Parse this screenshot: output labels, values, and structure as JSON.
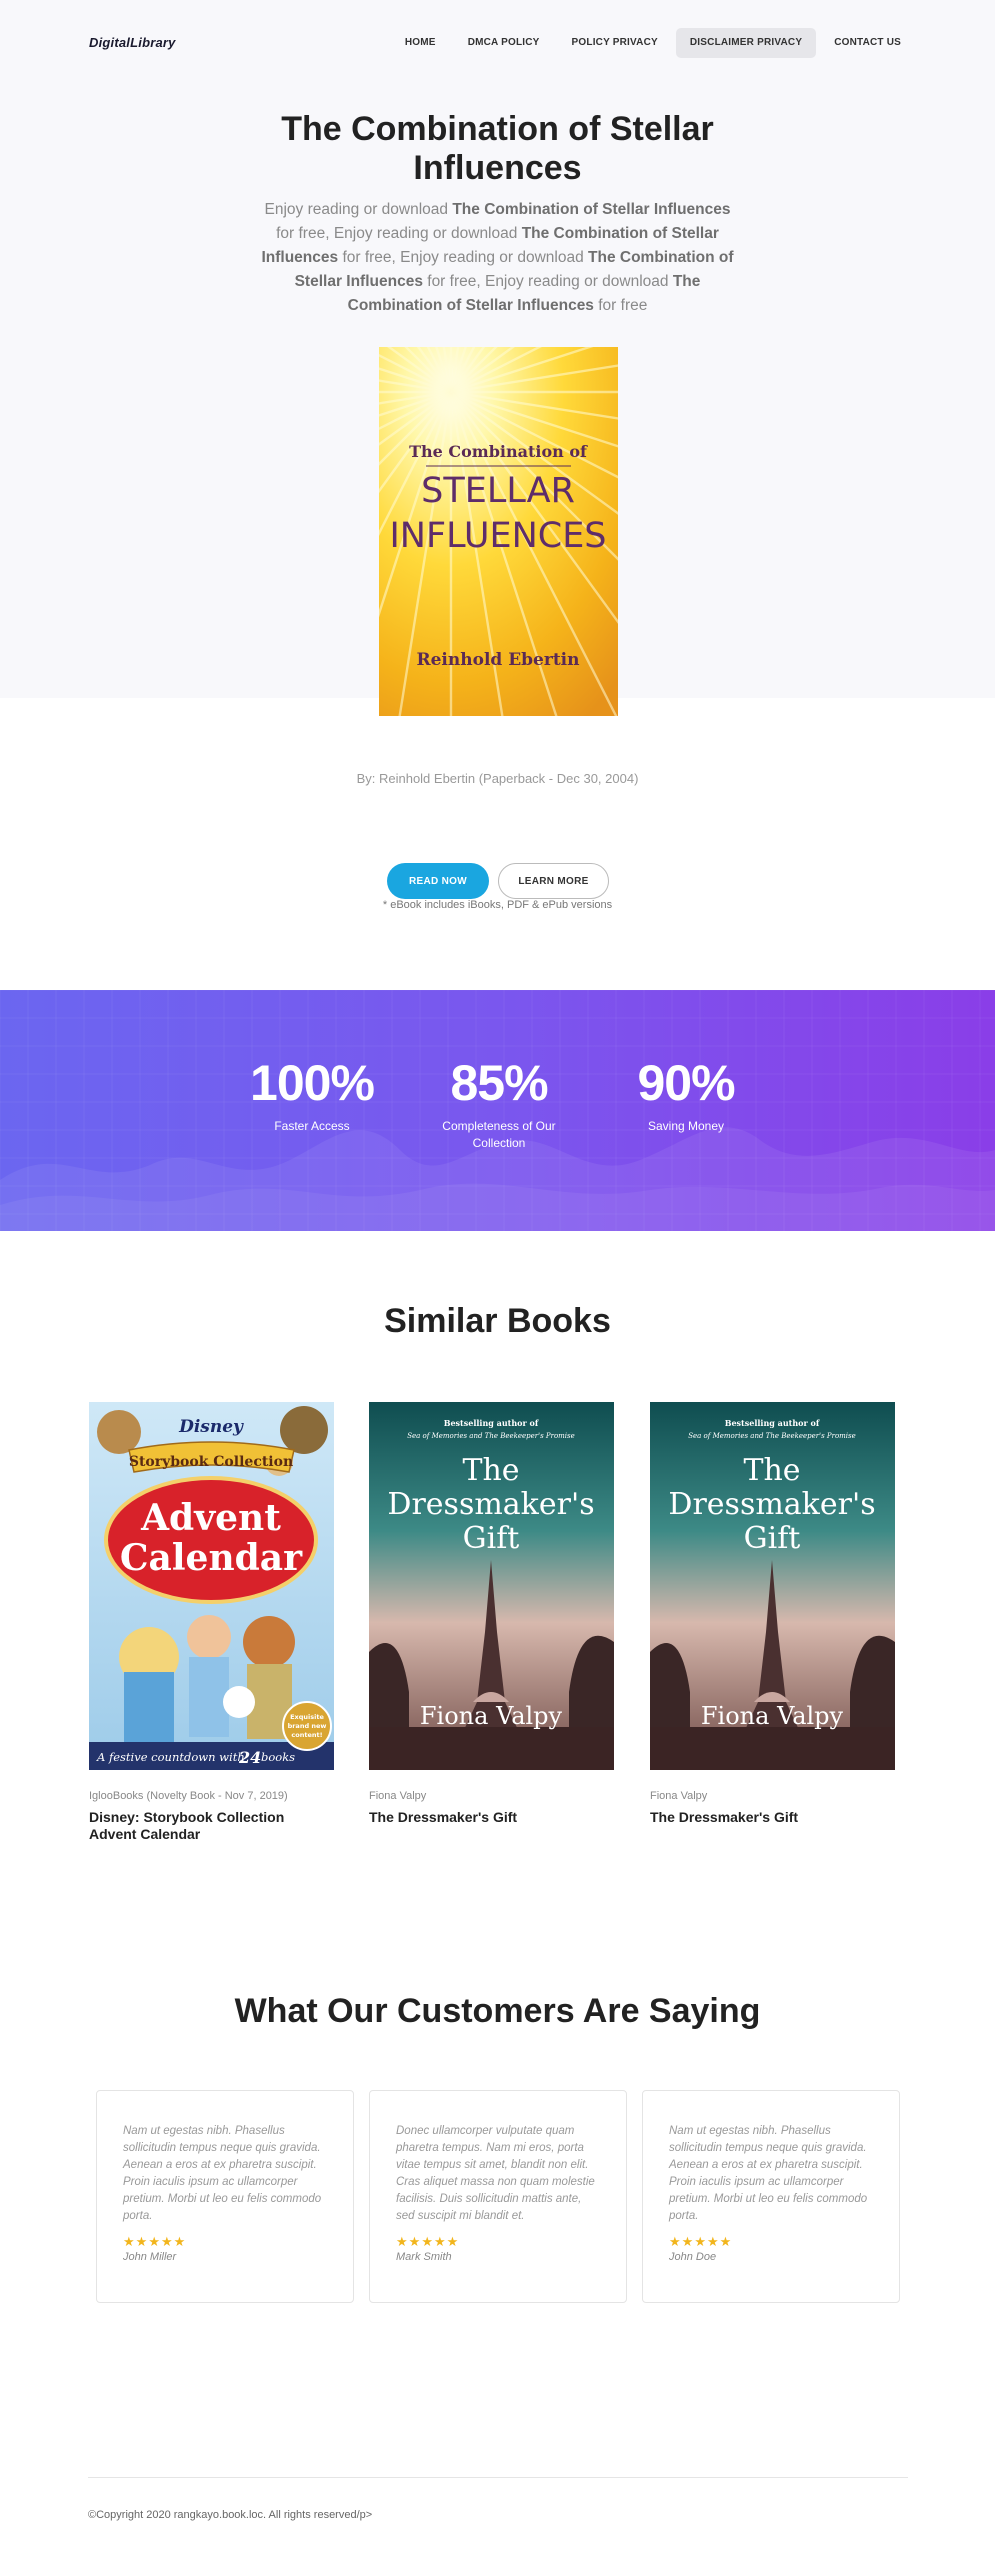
{
  "brand": {
    "logo": "DigitalLibrary"
  },
  "nav": {
    "items": [
      {
        "label": "HOME",
        "active": false
      },
      {
        "label": "DMCA POLICY",
        "active": false
      },
      {
        "label": "POLICY PRIVACY",
        "active": false
      },
      {
        "label": "DISCLAIMER PRIVACY",
        "active": true
      },
      {
        "label": "CONTACT US",
        "active": false
      }
    ]
  },
  "hero": {
    "title": "The Combination of Stellar Influences",
    "description_segments": [
      {
        "text": "Enjoy reading or download ",
        "bold": false
      },
      {
        "text": "The Combination of Stellar Influences",
        "bold": true
      },
      {
        "text": " for free, Enjoy reading or download ",
        "bold": false
      },
      {
        "text": "The Combination of Stellar Influences",
        "bold": true
      },
      {
        "text": " for free, Enjoy reading or download ",
        "bold": false
      },
      {
        "text": "The Combination of Stellar Influences",
        "bold": true
      },
      {
        "text": " for free, Enjoy reading or download ",
        "bold": false
      },
      {
        "text": "The Combination of Stellar Influences",
        "bold": true
      },
      {
        "text": " for free",
        "bold": false
      }
    ],
    "cover": {
      "title_line1": "The Combination of",
      "title_line2": "STELLAR",
      "title_line3": "INFLUENCES",
      "author": "Reinhold Ebertin"
    },
    "byline": "By: Reinhold Ebertin (Paperback - Dec 30, 2004)",
    "read_button": "READ NOW",
    "more_button": "LEARN MORE",
    "ebook_note": "* eBook includes iBooks, PDF & ePub versions"
  },
  "stats": [
    {
      "value": "100%",
      "label": "Faster Access"
    },
    {
      "value": "85%",
      "label": "Completeness of Our Collection"
    },
    {
      "value": "90%",
      "label": "Saving Money"
    }
  ],
  "similar": {
    "title": "Similar Books",
    "books": [
      {
        "meta": "IglooBooks (Novelty Book - Nov 7, 2019)",
        "title": "Disney: Storybook Collection Advent Calendar",
        "cover": {
          "brand": "Disney",
          "banner": "Storybook Collection",
          "line1": "Advent",
          "line2": "Calendar",
          "footer_prefix": "A festive countdown with",
          "footer_count": "24",
          "footer_suffix": "books",
          "badge_line1": "Exquisite",
          "badge_line2": "brand new",
          "badge_line3": "content!"
        }
      },
      {
        "meta": "Fiona Valpy",
        "title": "The Dressmaker's Gift",
        "cover": {
          "tagline1": "Bestselling author of",
          "tagline2": "Sea of Memories and The Beekeeper's Promise",
          "line1": "The",
          "line2": "Dressmaker's",
          "line3": "Gift",
          "author": "Fiona Valpy"
        }
      },
      {
        "meta": "Fiona Valpy",
        "title": "The Dressmaker's Gift",
        "cover": {
          "tagline1": "Bestselling author of",
          "tagline2": "Sea of Memories and The Beekeeper's Promise",
          "line1": "The",
          "line2": "Dressmaker's",
          "line3": "Gift",
          "author": "Fiona Valpy"
        }
      }
    ]
  },
  "testimonials": {
    "title": "What Our Customers Are Saying",
    "items": [
      {
        "quote": "Nam ut egestas nibh. Phasellus sollicitudin tempus neque quis gravida. Aenean a eros at ex pharetra suscipit. Proin iaculis ipsum ac ullamcorper pretium. Morbi ut leo eu felis commodo porta.",
        "stars": 5,
        "name": "John Miller"
      },
      {
        "quote": "Donec ullamcorper vulputate quam pharetra tempus. Nam mi eros, porta vitae tempus sit amet, blandit non elit. Cras aliquet massa non quam molestie facilisis. Duis sollicitudin mattis ante, sed suscipit mi blandit et.",
        "stars": 5,
        "name": "Mark Smith"
      },
      {
        "quote": "Nam ut egestas nibh. Phasellus sollicitudin tempus neque quis gravida. Aenean a eros at ex pharetra suscipit. Proin iaculis ipsum ac ullamcorper pretium. Morbi ut leo eu felis commodo porta.",
        "stars": 5,
        "name": "John Doe"
      }
    ]
  },
  "footer": {
    "copyright": "©Copyright 2020 rangkayo.book.loc. All rights reserved/p>"
  },
  "colors": {
    "accent_blue": "#1aa6e0",
    "stats_gradient_start": "#6b66f0",
    "stats_gradient_end": "#8a3ee8",
    "star": "#f2b51c"
  }
}
